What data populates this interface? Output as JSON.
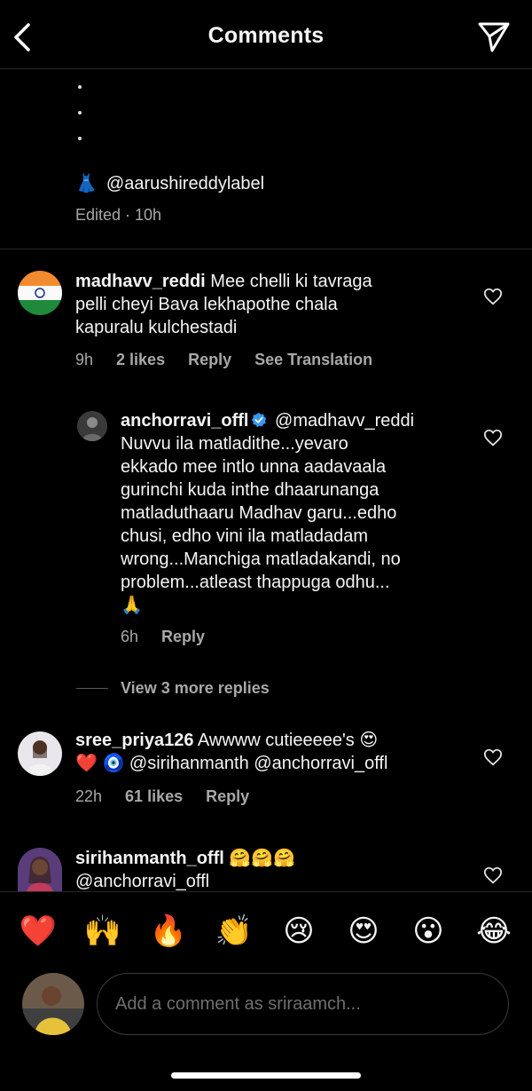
{
  "header": {
    "title": "Comments"
  },
  "caption": {
    "mention_emoji": "👗",
    "mention": "@aarushireddylabel",
    "edited": "Edited · 10h"
  },
  "comments": [
    {
      "username": "madhavv_reddi",
      "text_lines": [
        "Mee chelli ki tavraga",
        "pelli cheyi Bava lekhapothe chala",
        "kapuralu kulchestadi"
      ],
      "time": "9h",
      "likes": "2 likes",
      "reply": "Reply",
      "translate": "See Translation"
    },
    {
      "username": "anchorravi_offl",
      "mention": "@madhavv_reddi",
      "text_lines": [
        "Nuvvu ila matladithe...yevaro",
        "ekkado mee intlo unna aadavaala",
        "gurinchi kuda inthe dhaarunanga",
        "matladuthaaru Madhav garu...edho",
        "chusi, edho vini ila matladadam",
        "wrong...Manchiga matladakandi, no",
        "problem...atleast thappuga odhu...",
        "🙏"
      ],
      "time": "6h",
      "reply": "Reply"
    },
    {
      "username": "sree_priya126",
      "text_lines": [
        "Awwww cutieeeee's 😍",
        "❤️ 🧿 @sirihanmanth @anchorravi_offl"
      ],
      "time": "22h",
      "likes": "61 likes",
      "reply": "Reply"
    },
    {
      "username": "sirihanmanth_offl",
      "text_lines": [
        "🤗🤗🤗",
        "@anchorravi_offl"
      ]
    }
  ],
  "view_more": "View 3 more replies",
  "reactions": [
    "❤️",
    "🙌",
    "🔥",
    "👏",
    "😢",
    "😍",
    "😮",
    "😂"
  ],
  "composer": {
    "placeholder": "Add a comment as sriraamch..."
  }
}
